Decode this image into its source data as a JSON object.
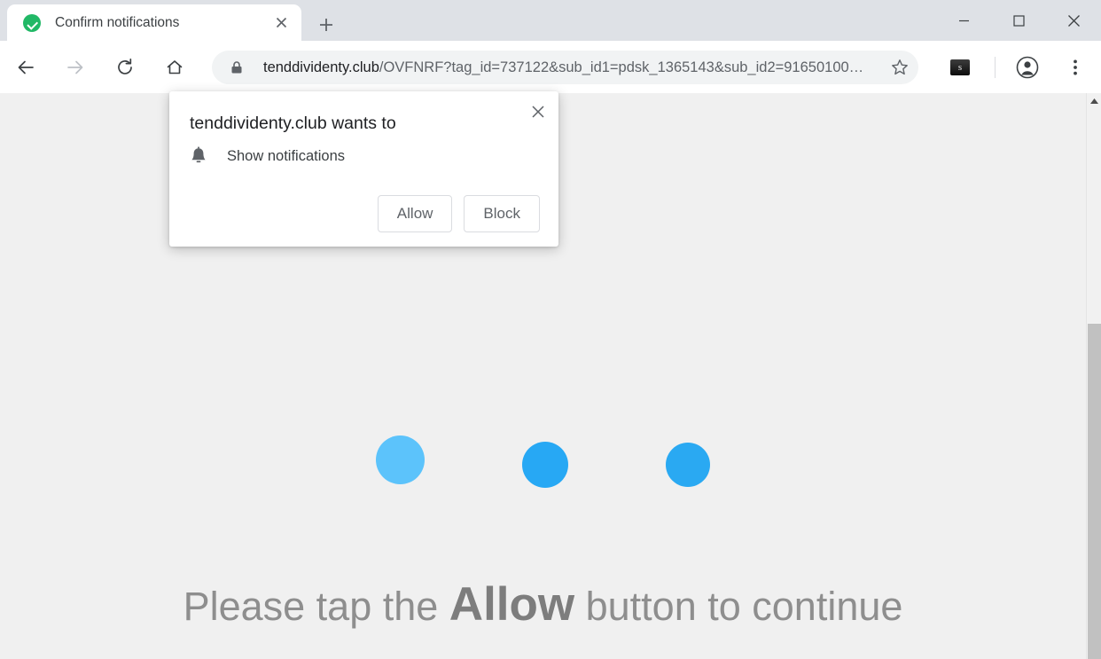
{
  "window": {
    "controls": [
      {
        "name": "minimize",
        "glyph": "minimize-icon"
      },
      {
        "name": "maximize",
        "glyph": "maximize-icon"
      },
      {
        "name": "close",
        "glyph": "close-icon"
      }
    ]
  },
  "tabstrip": {
    "active_tab": {
      "title": "Confirm notifications",
      "favicon": "green-check-icon",
      "close_label": "close-tab-icon"
    },
    "new_tab_label": "new-tab-icon"
  },
  "toolbar": {
    "back": "back-arrow-icon",
    "forward": "forward-arrow-icon",
    "reload": "reload-icon",
    "home": "home-icon",
    "security_icon": "lock-icon",
    "url_host": "tenddividenty.club",
    "url_path": "/OVFNRF?tag_id=737122&sub_id1=pdsk_1365143&sub_id2=91650100…",
    "url_full": "tenddividenty.club/OVFNRF?tag_id=737122&sub_id1=pdsk_1365143&sub_id2=91650100…",
    "bookmark": "star-icon",
    "extension_icon_glyph": "s",
    "profile": "account-avatar-icon",
    "menu": "three-dot-menu-icon"
  },
  "permission_dialog": {
    "title": "tenddividenty.club wants to",
    "permission_icon": "bell-icon",
    "permission_label": "Show notifications",
    "allow_label": "Allow",
    "block_label": "Block",
    "close_label": "close-dialog-icon"
  },
  "page": {
    "background_color": "#f0f0f0",
    "loader": {
      "dots": [
        {
          "color": "#5cc3fb",
          "size": 55
        },
        {
          "color": "#27a8f4",
          "size": 52
        },
        {
          "color": "#2aa9f2",
          "size": 50
        }
      ]
    },
    "headline": {
      "before": "Please tap the ",
      "emphasis": "Allow",
      "after": " button to continue",
      "color": "#8e8e8e"
    }
  },
  "scrollbar": {
    "up_arrow": "scroll-up-arrow-icon",
    "thumb_color": "#c1c1c1",
    "track_color": "#f1f1f1"
  },
  "colors": {
    "accent_blue": "#27a8f4",
    "favicon_green": "#21b866",
    "toolbar_bg": "#ffffff",
    "titlebar_bg": "#dee1e6",
    "omnibox_bg": "#f1f3f4"
  }
}
